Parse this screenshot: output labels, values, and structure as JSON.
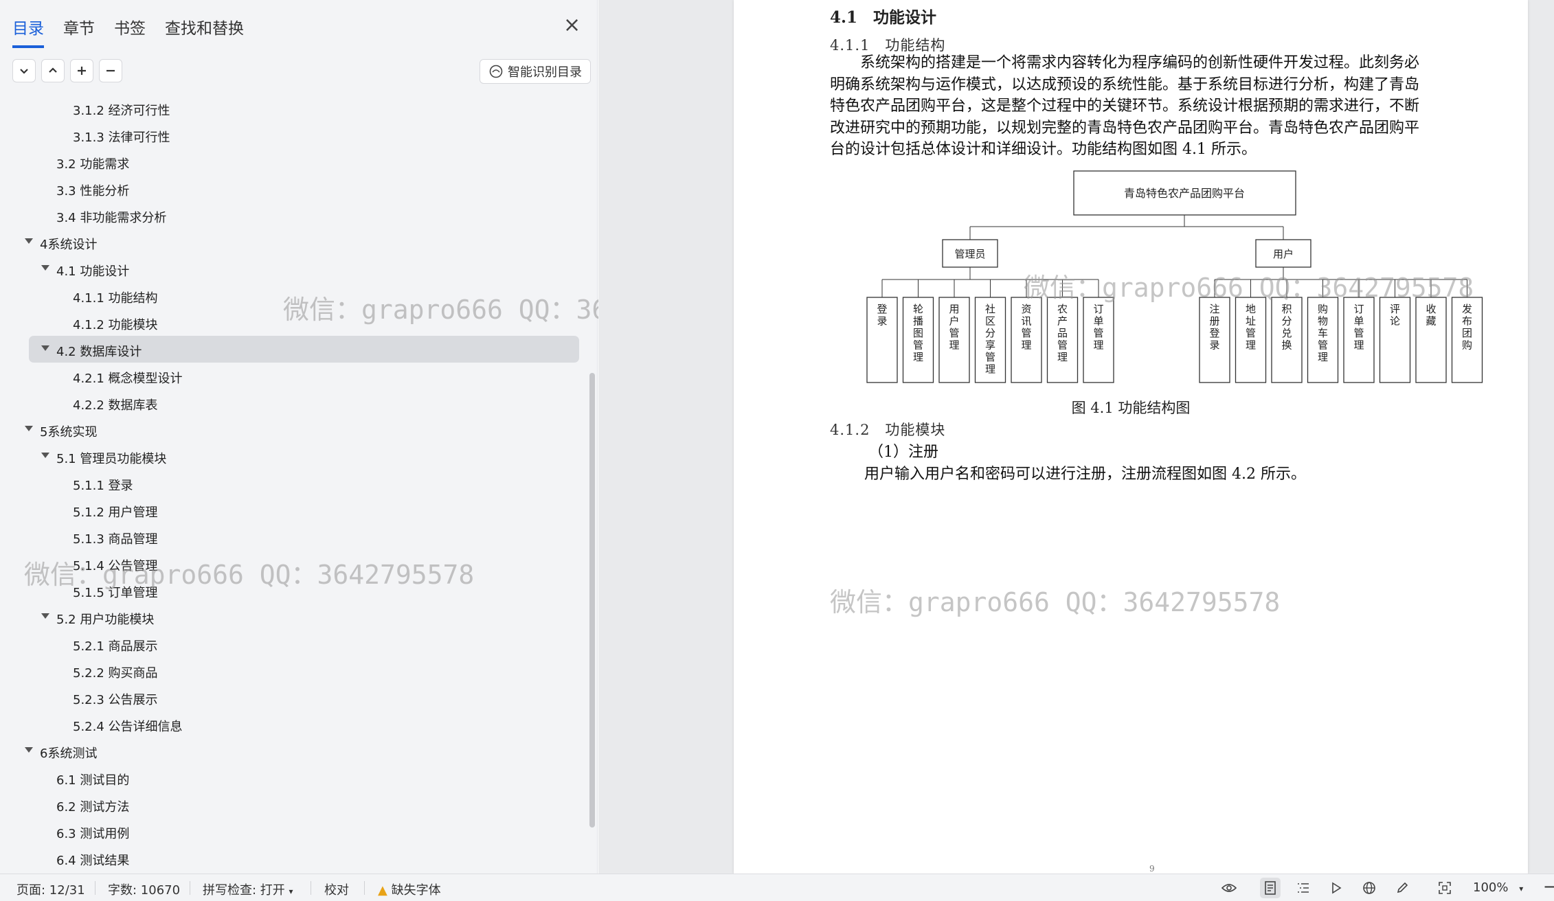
{
  "nav": {
    "tabs": [
      "目录",
      "章节",
      "书签",
      "查找和替换"
    ],
    "smart_toc": "智能识别目录",
    "toc": [
      {
        "label": "3.1.2 经济可行性",
        "level": 3
      },
      {
        "label": "3.1.3 法律可行性",
        "level": 3
      },
      {
        "label": "3.2 功能需求",
        "level": 2
      },
      {
        "label": "3.3 性能分析",
        "level": 2
      },
      {
        "label": "3.4 非功能需求分析",
        "level": 2
      },
      {
        "label": "4系统设计",
        "level": 1,
        "expanded": true
      },
      {
        "label": "4.1 功能设计",
        "level": 2,
        "expanded": true
      },
      {
        "label": "4.1.1 功能结构",
        "level": 3
      },
      {
        "label": "4.1.2 功能模块",
        "level": 3
      },
      {
        "label": "4.2 数据库设计",
        "level": 2,
        "expanded": true,
        "selected": true
      },
      {
        "label": "4.2.1 概念模型设计",
        "level": 3
      },
      {
        "label": "4.2.2 数据库表",
        "level": 3
      },
      {
        "label": "5系统实现",
        "level": 1,
        "expanded": true
      },
      {
        "label": "5.1 管理员功能模块",
        "level": 2,
        "expanded": true
      },
      {
        "label": "5.1.1 登录",
        "level": 3
      },
      {
        "label": "5.1.2 用户管理",
        "level": 3
      },
      {
        "label": "5.1.3 商品管理",
        "level": 3
      },
      {
        "label": "5.1.4 公告管理",
        "level": 3
      },
      {
        "label": "5.1.5 订单管理",
        "level": 3
      },
      {
        "label": "5.2 用户功能模块",
        "level": 2,
        "expanded": true
      },
      {
        "label": "5.2.1 商品展示",
        "level": 3
      },
      {
        "label": "5.2.2 购买商品",
        "level": 3
      },
      {
        "label": "5.2.3 公告展示",
        "level": 3
      },
      {
        "label": "5.2.4 公告详细信息",
        "level": 3
      },
      {
        "label": "6系统测试",
        "level": 1,
        "expanded": true
      },
      {
        "label": "6.1 测试目的",
        "level": 2
      },
      {
        "label": "6.2 测试方法",
        "level": 2
      },
      {
        "label": "6.3 测试用例",
        "level": 2
      },
      {
        "label": "6.4 测试结果",
        "level": 2
      }
    ]
  },
  "doc": {
    "heading_41": "4.1　功能设计",
    "heading_411": "4.1.1　功能结构",
    "para_1": [
      "　　系统架构的搭建是一个将需求内容转化为程序编码的创新性硬件开发过程。此刻务必",
      "明确系统架构与运作模式，以达成预设的系统性能。基于系统目标进行分析，构建了青岛",
      "特色农产品团购平台，这是整个过程中的关键环节。系统设计根据预期的需求进行，不断",
      "改进研究中的预期功能，以规划完整的青岛特色农产品团购平台。青岛特色农产品团购平",
      "台的设计包括总体设计和详细设计。功能结构图如图 4.1 所示。"
    ],
    "diagram": {
      "root": "青岛特色农产品团购平台",
      "admin": "管理员",
      "user": "用户",
      "admin_items": [
        "登录",
        "轮播图管理",
        "用户管理",
        "社区分享管理",
        "资讯管理",
        "农产品管理",
        "订单管理"
      ],
      "user_items": [
        "注册登录",
        "地址管理",
        "积分兑换",
        "购物车管理",
        "订单管理",
        "评论",
        "收藏",
        "发布团购"
      ]
    },
    "figure_caption": "图 4.1  功能结构图",
    "heading_412": "4.1.2　功能模块",
    "sub_1": "（1）注册",
    "para_2": "用户输入用户名和密码可以进行注册，注册流程图如图 4.2 所示。",
    "page_number": "9"
  },
  "watermark": "微信：grapro666 QQ：3642795578",
  "status": {
    "page": "页面: 12/31",
    "words": "字数: 10670",
    "spell": "拼写检查: 打开",
    "proof": "校对",
    "missing_font": "缺失字体",
    "zoom": "100%"
  }
}
